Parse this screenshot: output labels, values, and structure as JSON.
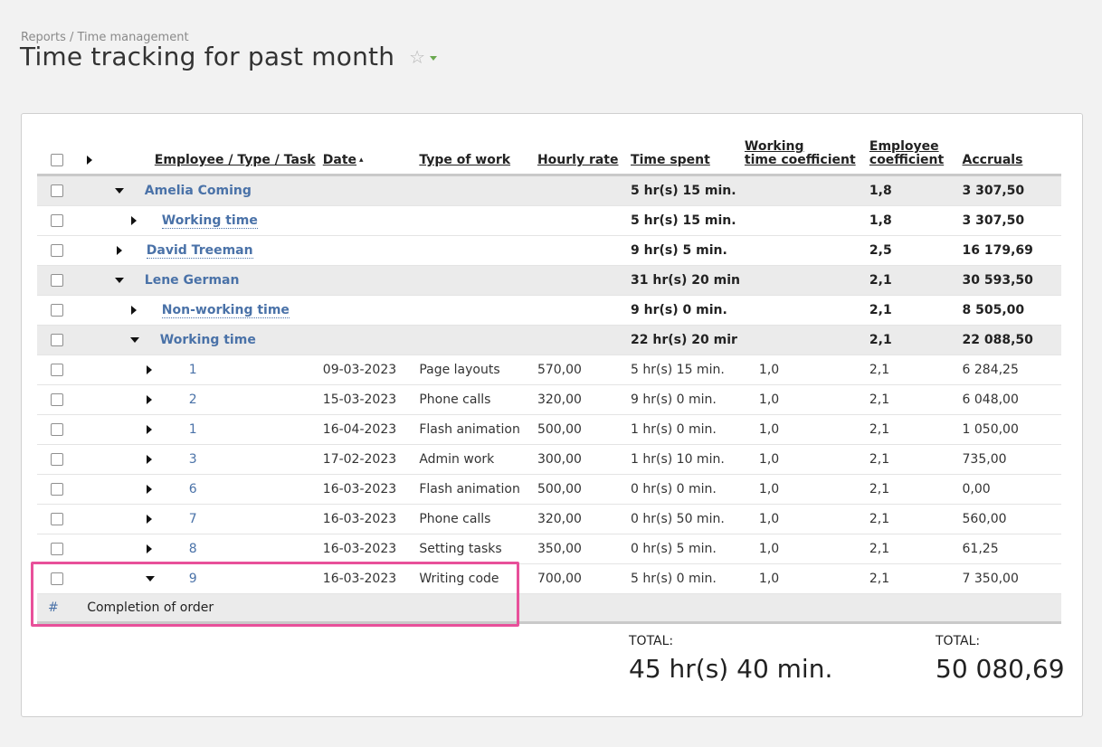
{
  "breadcrumb": "Reports / Time management",
  "title": "Time tracking for past month",
  "columns": {
    "employee": "Employee / Type / Task",
    "date": "Date",
    "type": "Type of work",
    "rate": "Hourly rate",
    "time": "Time spent",
    "wtc_line1": "Working",
    "wtc_line2": "time coefficient",
    "ec_line1": "Employee",
    "ec_line2": "coefficient",
    "accruals": "Accruals"
  },
  "rows": [
    {
      "kind": "group",
      "level": 0,
      "expanded": true,
      "name": "Amelia Coming",
      "time": "5 hr(s) 15 min.",
      "emp_coef": "1,8",
      "accruals": "3 307,50"
    },
    {
      "kind": "sub",
      "level": 1,
      "expanded": false,
      "name": "Working time",
      "time": "5 hr(s) 15 min.",
      "emp_coef": "1,8",
      "accruals": "3 307,50"
    },
    {
      "kind": "sub",
      "level": 0,
      "expanded": false,
      "name": "David Treeman",
      "time": "9 hr(s) 5 min.",
      "emp_coef": "2,5",
      "accruals": "16 179,69"
    },
    {
      "kind": "group",
      "level": 0,
      "expanded": true,
      "name": "Lene German",
      "time": "31 hr(s) 20 min",
      "emp_coef": "2,1",
      "accruals": "30 593,50"
    },
    {
      "kind": "sub",
      "level": 1,
      "expanded": false,
      "name": "Non-working time",
      "time": "9 hr(s) 0 min.",
      "emp_coef": "2,1",
      "accruals": "8 505,00"
    },
    {
      "kind": "group",
      "level": 1,
      "expanded": true,
      "name": "Working time",
      "time": "22 hr(s) 20 mir",
      "emp_coef": "2,1",
      "accruals": "22 088,50"
    },
    {
      "kind": "task",
      "expanded": false,
      "name": "1",
      "date": "09-03-2023",
      "type": "Page layouts",
      "rate": "570,00",
      "time": "5 hr(s) 15 min.",
      "wtc": "1,0",
      "emp_coef": "2,1",
      "accruals": "6 284,25"
    },
    {
      "kind": "task",
      "expanded": false,
      "name": "2",
      "date": "15-03-2023",
      "type": "Phone calls",
      "rate": "320,00",
      "time": "9 hr(s) 0 min.",
      "wtc": "1,0",
      "emp_coef": "2,1",
      "accruals": "6 048,00"
    },
    {
      "kind": "task",
      "expanded": false,
      "name": "1",
      "date": "16-04-2023",
      "type": "Flash animation",
      "rate": "500,00",
      "time": "1 hr(s) 0 min.",
      "wtc": "1,0",
      "emp_coef": "2,1",
      "accruals": "1 050,00"
    },
    {
      "kind": "task",
      "expanded": false,
      "name": "3",
      "date": "17-02-2023",
      "type": "Admin work",
      "rate": "300,00",
      "time": "1 hr(s) 10 min.",
      "wtc": "1,0",
      "emp_coef": "2,1",
      "accruals": "735,00"
    },
    {
      "kind": "task",
      "expanded": false,
      "name": "6",
      "date": "16-03-2023",
      "type": "Flash animation",
      "rate": "500,00",
      "time": "0 hr(s) 0 min.",
      "wtc": "1,0",
      "emp_coef": "2,1",
      "accruals": "0,00"
    },
    {
      "kind": "task",
      "expanded": false,
      "name": "7",
      "date": "16-03-2023",
      "type": "Phone calls",
      "rate": "320,00",
      "time": "0 hr(s) 50 min.",
      "wtc": "1,0",
      "emp_coef": "2,1",
      "accruals": "560,00"
    },
    {
      "kind": "task",
      "expanded": false,
      "name": "8",
      "date": "16-03-2023",
      "type": "Setting tasks",
      "rate": "350,00",
      "time": "0 hr(s) 5 min.",
      "wtc": "1,0",
      "emp_coef": "2,1",
      "accruals": "61,25"
    },
    {
      "kind": "task",
      "expanded": true,
      "name": "9",
      "date": "16-03-2023",
      "type": "Writing code",
      "rate": "700,00",
      "time": "5 hr(s) 0 min.",
      "wtc": "1,0",
      "emp_coef": "2,1",
      "accruals": "7 350,00"
    }
  ],
  "comment": {
    "hash": "#",
    "text": "Completion of order"
  },
  "totals": {
    "time_label": "TOTAL:",
    "time_value": "45 hr(s) 40 min.",
    "accruals_label": "TOTAL:",
    "accruals_value": "50 080,69"
  },
  "colors": {
    "link": "#4a72a8",
    "highlight": "#e8509a",
    "group_bg": "#ebebeb"
  },
  "icons": {
    "favorite": "star-icon",
    "menu": "caret-down-icon"
  }
}
